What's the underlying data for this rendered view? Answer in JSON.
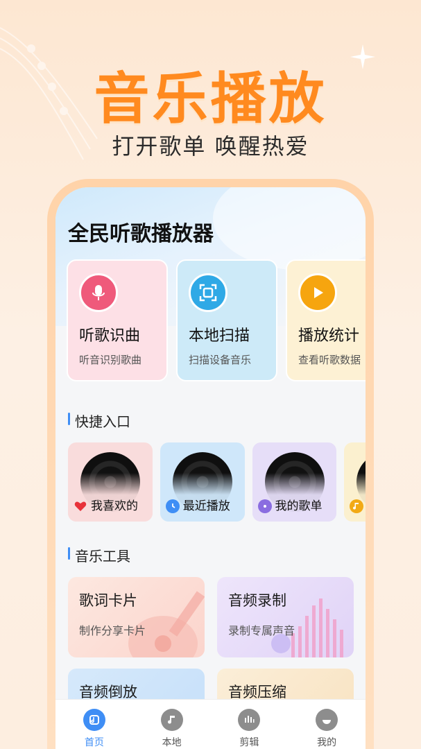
{
  "hero": {
    "title": "音乐播放",
    "subtitle": "打开歌单 唤醒热爱"
  },
  "app": {
    "title": "全民听歌播放器",
    "features": [
      {
        "title": "听歌识曲",
        "subtitle": "听音识别歌曲",
        "icon": "mic-music-icon",
        "color": "#ef5a7b"
      },
      {
        "title": "本地扫描",
        "subtitle": "扫描设备音乐",
        "icon": "scan-icon",
        "color": "#2fa9e6"
      },
      {
        "title": "播放统计",
        "subtitle": "查看听歌数据",
        "icon": "play-stats-icon",
        "color": "#f6a50f"
      }
    ],
    "quick_section_title": "快捷入口",
    "quick_items": [
      {
        "label": "我喜欢的",
        "icon": "heart-icon"
      },
      {
        "label": "最近播放",
        "icon": "clock-icon"
      },
      {
        "label": "我的歌单",
        "icon": "disc-icon"
      },
      {
        "label": "",
        "icon": "note-icon"
      }
    ],
    "tools_section_title": "音乐工具",
    "tools": [
      {
        "title": "歌词卡片",
        "subtitle": "制作分享卡片"
      },
      {
        "title": "音频录制",
        "subtitle": "录制专属声音"
      },
      {
        "title": "音频倒放",
        "subtitle": ""
      },
      {
        "title": "音频压缩",
        "subtitle": ""
      }
    ],
    "nav": [
      {
        "label": "首页",
        "icon": "home-music-icon",
        "active": true
      },
      {
        "label": "本地",
        "icon": "local-music-icon",
        "active": false
      },
      {
        "label": "剪辑",
        "icon": "edit-audio-icon",
        "active": false
      },
      {
        "label": "我的",
        "icon": "profile-icon",
        "active": false
      }
    ]
  },
  "colors": {
    "accent_orange": "#ff8a1f",
    "accent_blue": "#3f8ef5"
  }
}
